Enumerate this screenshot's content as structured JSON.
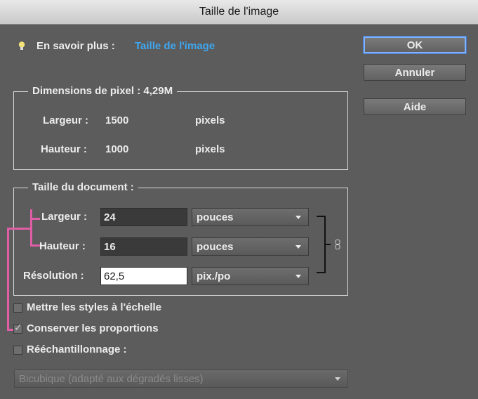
{
  "window": {
    "title": "Taille de l'image"
  },
  "learn_more": {
    "prefix": "En savoir plus :",
    "link": "Taille de l'image"
  },
  "buttons": {
    "ok": "OK",
    "cancel": "Annuler",
    "help": "Aide"
  },
  "pixel_dimensions": {
    "title": "Dimensions de pixel :",
    "size": "4,29M",
    "width_label": "Largeur :",
    "width_value": "1500",
    "width_unit": "pixels",
    "height_label": "Hauteur :",
    "height_value": "1000",
    "height_unit": "pixels"
  },
  "document_size": {
    "title": "Taille du document :",
    "width_label": "Largeur :",
    "width_value": "24",
    "width_unit": "pouces",
    "height_label": "Hauteur :",
    "height_value": "16",
    "height_unit": "pouces",
    "resolution_label": "Résolution :",
    "resolution_value": "62,5",
    "resolution_unit": "pix./po"
  },
  "options": {
    "scale_styles": {
      "label": "Mettre les styles à l'échelle",
      "checked": false
    },
    "constrain": {
      "label": "Conserver les proportions",
      "checked": true
    },
    "resample": {
      "label": "Rééchantillonnage :",
      "checked": false
    },
    "method": "Bicubique (adapté aux dégradés lisses)"
  },
  "colors": {
    "link": "#3fa7f0",
    "annotation": "#e05ea5",
    "accent": "#7fb3ff"
  },
  "icons": [
    "lightbulb-icon",
    "chain-link-icon",
    "chevron-down-icon",
    "checkmark-icon"
  ]
}
